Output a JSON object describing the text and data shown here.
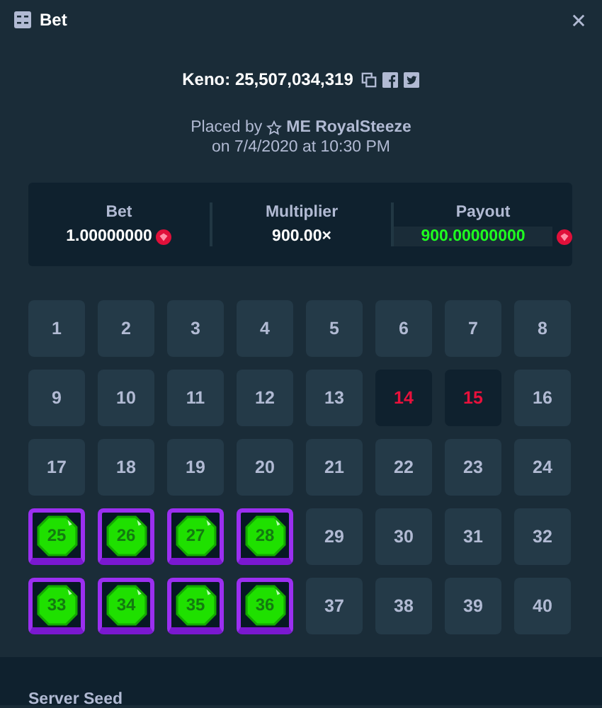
{
  "window": {
    "title": "Bet"
  },
  "bet_id": {
    "label": "Keno:",
    "value": "25,507,034,319"
  },
  "placed_by": {
    "prefix": "Placed by",
    "user": "ME RoyalSteeze",
    "date": "on 7/4/2020 at 10:30 PM"
  },
  "stats": [
    {
      "label": "Bet",
      "value": "1.00000000",
      "kind": "currency",
      "win": false
    },
    {
      "label": "Multiplier",
      "value": "900.00×",
      "kind": "plain",
      "win": false
    },
    {
      "label": "Payout",
      "value": "900.00000000",
      "kind": "currency",
      "win": true
    }
  ],
  "tiles": [
    {
      "number": "1",
      "kind": "plain"
    },
    {
      "number": "2",
      "kind": "plain"
    },
    {
      "number": "3",
      "kind": "plain"
    },
    {
      "number": "4",
      "kind": "plain"
    },
    {
      "number": "5",
      "kind": "plain"
    },
    {
      "number": "6",
      "kind": "plain"
    },
    {
      "number": "7",
      "kind": "plain"
    },
    {
      "number": "8",
      "kind": "plain"
    },
    {
      "number": "9",
      "kind": "plain"
    },
    {
      "number": "10",
      "kind": "plain"
    },
    {
      "number": "11",
      "kind": "plain"
    },
    {
      "number": "12",
      "kind": "plain"
    },
    {
      "number": "13",
      "kind": "plain"
    },
    {
      "number": "14",
      "kind": "miss"
    },
    {
      "number": "15",
      "kind": "miss"
    },
    {
      "number": "16",
      "kind": "plain"
    },
    {
      "number": "17",
      "kind": "plain"
    },
    {
      "number": "18",
      "kind": "plain"
    },
    {
      "number": "19",
      "kind": "plain"
    },
    {
      "number": "20",
      "kind": "plain"
    },
    {
      "number": "21",
      "kind": "plain"
    },
    {
      "number": "22",
      "kind": "plain"
    },
    {
      "number": "23",
      "kind": "plain"
    },
    {
      "number": "24",
      "kind": "plain"
    },
    {
      "number": "25",
      "kind": "hit"
    },
    {
      "number": "26",
      "kind": "hit"
    },
    {
      "number": "27",
      "kind": "hit"
    },
    {
      "number": "28",
      "kind": "hit"
    },
    {
      "number": "29",
      "kind": "plain"
    },
    {
      "number": "30",
      "kind": "plain"
    },
    {
      "number": "31",
      "kind": "plain"
    },
    {
      "number": "32",
      "kind": "plain"
    },
    {
      "number": "33",
      "kind": "hit"
    },
    {
      "number": "34",
      "kind": "hit"
    },
    {
      "number": "35",
      "kind": "hit"
    },
    {
      "number": "36",
      "kind": "hit"
    },
    {
      "number": "37",
      "kind": "plain"
    },
    {
      "number": "38",
      "kind": "plain"
    },
    {
      "number": "39",
      "kind": "plain"
    },
    {
      "number": "40",
      "kind": "plain"
    }
  ],
  "footer": {
    "label": "Server Seed"
  }
}
